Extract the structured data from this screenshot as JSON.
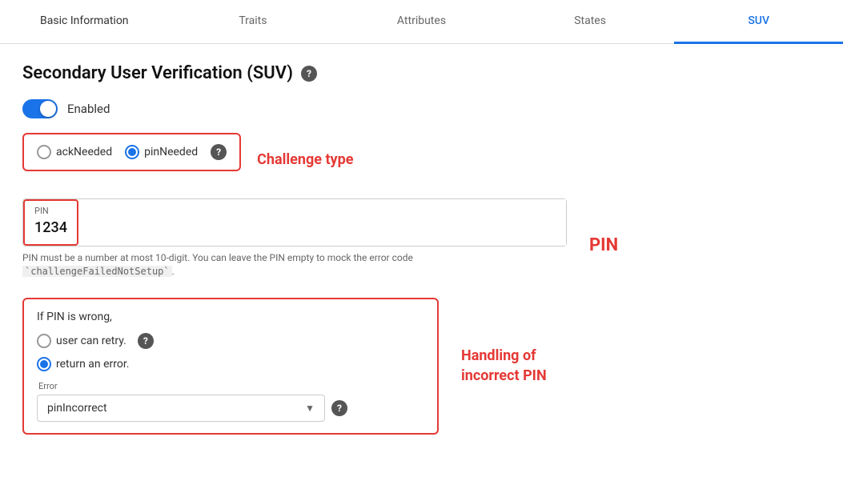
{
  "tabs": [
    {
      "id": "basic-information",
      "label": "Basic Information",
      "active": false
    },
    {
      "id": "traits",
      "label": "Traits",
      "active": false
    },
    {
      "id": "attributes",
      "label": "Attributes",
      "active": false
    },
    {
      "id": "states",
      "label": "States",
      "active": false
    },
    {
      "id": "suv",
      "label": "SUV",
      "active": true
    }
  ],
  "page": {
    "title": "Secondary User Verification (SUV)",
    "help_icon": "?",
    "toggle_label": "Enabled",
    "toggle_on": true,
    "challenge_type": {
      "label": "Challenge type",
      "options": [
        {
          "id": "ack",
          "label": "ackNeeded",
          "selected": false
        },
        {
          "id": "pin",
          "label": "pinNeeded",
          "selected": true
        }
      ]
    },
    "pin": {
      "field_label": "PIN",
      "field_value": "1234",
      "label_red": "PIN",
      "hint": "PIN must be a number at most 10-digit. You can leave the PIN empty to mock the error code `challengeFailedNotSetup`."
    },
    "incorrect_pin": {
      "title": "If PIN is wrong,",
      "options": [
        {
          "id": "retry",
          "label": "user can retry.",
          "selected": false
        },
        {
          "id": "error",
          "label": "return an error.",
          "selected": true
        }
      ],
      "error_label": "Error",
      "error_value": "pinIncorrect",
      "label_red": "Handling of\nincorrect PIN"
    }
  }
}
